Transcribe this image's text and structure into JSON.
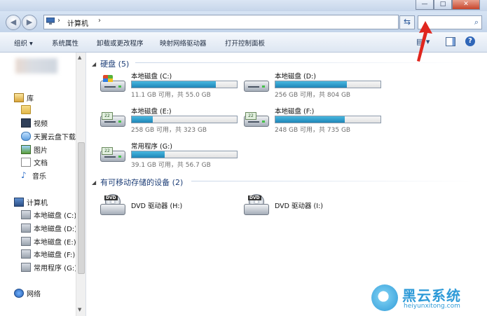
{
  "window": {
    "buttons": [
      "—",
      "□",
      "✕"
    ]
  },
  "address": {
    "path": [
      "计算机"
    ],
    "search_placeholder": ""
  },
  "toolbar": {
    "organize": "组织 ▾",
    "system_properties": "系统属性",
    "uninstall": "卸载或更改程序",
    "map_drive": "映射网络驱动器",
    "control_panel": "打开控制面板"
  },
  "sidebar": {
    "library": "库",
    "library_items": [
      "视频",
      "天翼云盘下载",
      "图片",
      "文档",
      "音乐"
    ],
    "computer": "计算机",
    "computer_items": [
      "本地磁盘 (C:)",
      "本地磁盘 (D:)",
      "本地磁盘 (E:)",
      "本地磁盘 (F:)",
      "常用程序 (G:)"
    ],
    "network": "网络"
  },
  "groups": {
    "hdd": "硬盘 (5)",
    "removable": "有可移动存储的设备 (2)"
  },
  "drives": [
    {
      "name": "本地磁盘 (C:)",
      "size": "11.1 GB 可用，共 55.0 GB",
      "used": 0.8,
      "icon": "windows-drive-icon"
    },
    {
      "name": "本地磁盘 (D:)",
      "size": "256 GB 可用，共 804 GB",
      "used": 0.68,
      "icon": "hard-drive-icon"
    },
    {
      "name": "本地磁盘 (E:)",
      "size": "258 GB 可用，共 323 GB",
      "used": 0.2,
      "icon": "hard-drive-icon"
    },
    {
      "name": "本地磁盘 (F:)",
      "size": "248 GB 可用，共 735 GB",
      "used": 0.66,
      "icon": "hard-drive-icon"
    },
    {
      "name": "常用程序 (G:)",
      "size": "39.1 GB 可用，共 56.7 GB",
      "used": 0.31,
      "icon": "hard-drive-icon"
    }
  ],
  "dvd_drives": [
    {
      "name": "DVD 驱动器 (H:)",
      "badge": "DVD"
    },
    {
      "name": "DVD 驱动器 (I:)",
      "badge": "DVD"
    }
  ],
  "watermark": {
    "cn": "黑云系统",
    "en": "heiyunxitong.com"
  },
  "colors": {
    "accent": "#1f86b8",
    "annotation": "#e0261e"
  }
}
